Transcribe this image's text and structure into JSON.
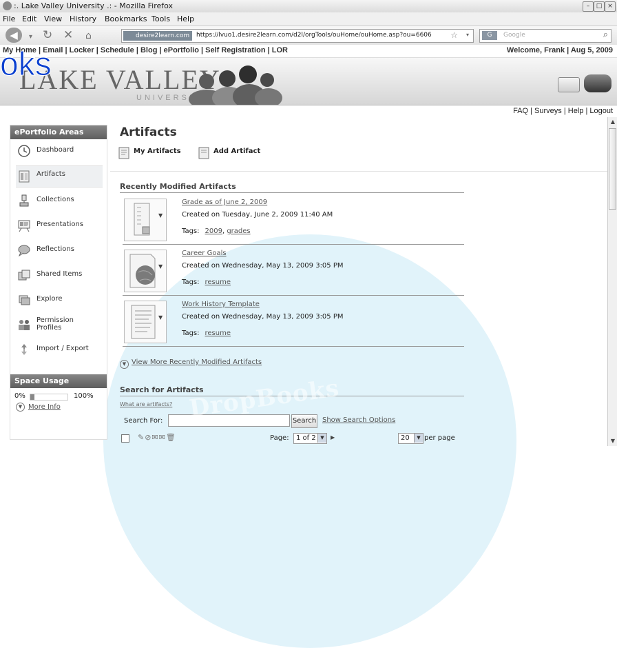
{
  "window": {
    "title": ":. Lake Valley University .: - Mozilla Firefox"
  },
  "menu": [
    "File",
    "Edit",
    "View",
    "History",
    "Bookmarks",
    "Tools",
    "Help"
  ],
  "browser": {
    "site_badge": "desire2learn.com",
    "url": "https://lvuo1.desire2learn.com/d2l/orgTools/ouHome/ouHome.asp?ou=6606",
    "search_placeholder": "Google",
    "search_engine": "G"
  },
  "site_nav": {
    "links": "My Home | Email | Locker | Schedule | Blog | ePortfolio | Self Registration | LOR",
    "welcome": "Welcome, Frank | Aug 5, 2009"
  },
  "banner": {
    "logo": "LAKE VALLEY",
    "logo_sub": "UNIVERSITY"
  },
  "utility_links": "FAQ | Surveys | Help | Logout",
  "sidebar": {
    "heading": "ePortfolio Areas",
    "items": [
      {
        "label": "Dashboard",
        "icon": "clock-icon"
      },
      {
        "label": "Artifacts",
        "icon": "artifacts-icon",
        "active": true
      },
      {
        "label": "Collections",
        "icon": "clip-icon"
      },
      {
        "label": "Presentations",
        "icon": "presentation-icon"
      },
      {
        "label": "Reflections",
        "icon": "bubble-icon"
      },
      {
        "label": "Shared Items",
        "icon": "shared-icon"
      },
      {
        "label": "Explore",
        "icon": "explore-icon"
      },
      {
        "label": "Permission",
        "label2": "Profiles",
        "icon": "people-icon"
      },
      {
        "label": "Import / Export",
        "icon": "arrows-icon"
      }
    ],
    "space_heading": "Space Usage",
    "space_min": "0%",
    "space_max": "100%",
    "space_used_fraction": 0.12,
    "more_info": "More Info"
  },
  "main": {
    "title": "Artifacts",
    "tabs": [
      "My Artifacts",
      "Add Artifact"
    ],
    "recent_heading": "Recently Modified Artifacts",
    "artifacts": [
      {
        "title": "Grade as of June 2, 2009",
        "created": "Created on Tuesday, June 2, 2009 11:40 AM",
        "tags_label": "Tags:",
        "tags": [
          "2009",
          "grades"
        ]
      },
      {
        "title": "Career Goals",
        "created": "Created on Wednesday, May 13, 2009 3:05 PM",
        "tags_label": "Tags:",
        "tags": [
          "resume"
        ]
      },
      {
        "title": "Work History Template",
        "created": "Created on Wednesday, May 13, 2009 3:05 PM",
        "tags_label": "Tags:",
        "tags": [
          "resume"
        ]
      }
    ],
    "view_more": "View More Recently Modified Artifacts",
    "search_heading": "Search for Artifacts",
    "what_are": "What are artifacts?",
    "search_for_label": "Search For:",
    "search_button": "Search",
    "show_options": "Show Search Options",
    "page_label": "Page:",
    "page_value": "1 of 2",
    "per_page_value": "20",
    "per_page_label": "per page"
  },
  "watermark": {
    "overlay": "oks",
    "text": "DropBooks"
  }
}
